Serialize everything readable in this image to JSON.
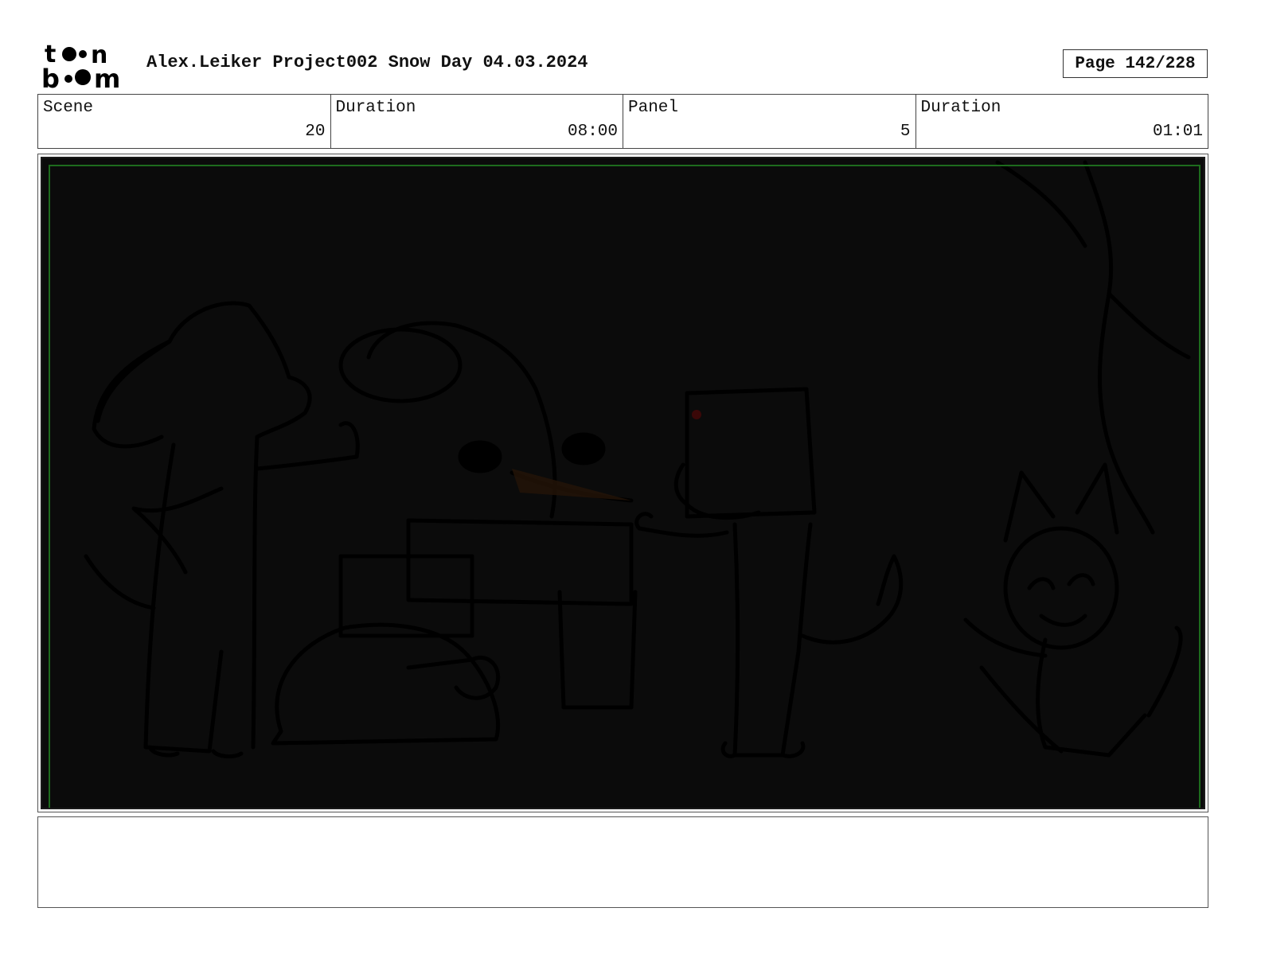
{
  "header": {
    "logo_top": "to•n",
    "logo_bottom": "b••m",
    "title": "Alex.Leiker Project002 Snow Day 04.03.2024",
    "page_label": "Page 142/228"
  },
  "info": {
    "scene_label": "Scene",
    "scene_value": "20",
    "scene_duration_label": "Duration",
    "scene_duration_value": "08:00",
    "panel_label": "Panel",
    "panel_value": "5",
    "panel_duration_label": "Duration",
    "panel_duration_value": "01:01"
  },
  "notes": {
    "text": ""
  },
  "colors": {
    "panel_background": "#0b0b0b",
    "safe_frame": "#1d6b1d",
    "line_art": "#000000"
  }
}
